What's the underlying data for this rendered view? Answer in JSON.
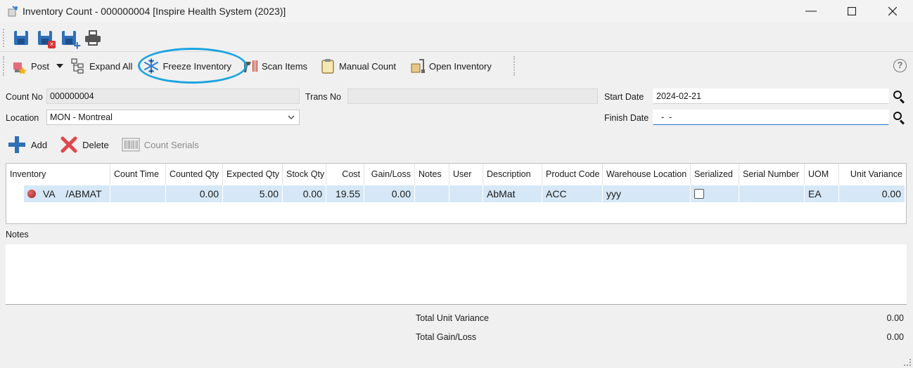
{
  "window": {
    "title": "Inventory Count - 000000004 [Inspire Health System (2023)]",
    "minimize": "—",
    "maximize": "☐",
    "close": "✕"
  },
  "toolbar2": {
    "post": "Post",
    "expand_all": "Expand All",
    "freeze_inventory": "Freeze Inventory",
    "scan_items": "Scan Items",
    "manual_count": "Manual Count",
    "open_inventory": "Open Inventory",
    "help": "?"
  },
  "form": {
    "count_no_label": "Count No",
    "count_no": "000000004",
    "trans_no_label": "Trans No",
    "trans_no": "",
    "start_date_label": "Start Date",
    "start_date": "2024-02-21",
    "location_label": "Location",
    "location": "MON - Montreal",
    "finish_date_label": "Finish Date",
    "finish_date": "  -  -"
  },
  "actions": {
    "add": "Add",
    "delete": "Delete",
    "count_serials": "Count Serials"
  },
  "grid": {
    "headers": [
      "Inventory",
      "Count Time",
      "Counted Qty",
      "Expected Qty",
      "Stock Qty",
      "Cost",
      "Gain/Loss",
      "Notes",
      "User",
      "Description",
      "Product Code",
      "Warehouse Location",
      "Serialized",
      "Serial Number",
      "UOM",
      "Unit Variance"
    ],
    "rows": [
      {
        "inventory": "VA    /ABMAT",
        "count_time": "",
        "counted_qty": "0.00",
        "expected_qty": "5.00",
        "stock_qty": "0.00",
        "cost": "19.55",
        "gain_loss": "0.00",
        "notes": "",
        "user": "",
        "description": "AbMat",
        "product_code": "ACC",
        "warehouse_location": "yyy",
        "serialized": false,
        "serial_number": "",
        "uom": "EA",
        "unit_variance": "0.00"
      }
    ]
  },
  "notes": {
    "label": "Notes",
    "value": ""
  },
  "totals": {
    "unit_variance_label": "Total Unit Variance",
    "unit_variance": "0.00",
    "gain_loss_label": "Total Gain/Loss",
    "gain_loss": "0.00"
  },
  "colors": {
    "accent": "#2f6fb7",
    "highlight_circle": "#1aa3df",
    "selected_row": "#d6e8f7",
    "delete_red": "#e0474c"
  }
}
